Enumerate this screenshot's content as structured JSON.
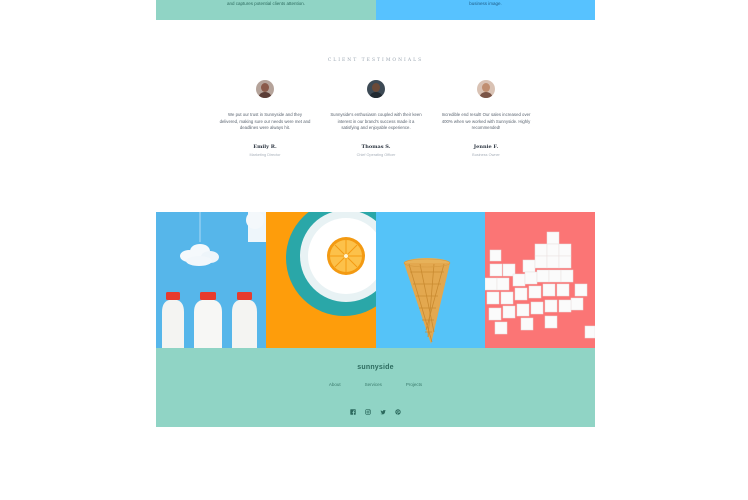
{
  "top_strip": {
    "left_text": "and captures potential clients attention.",
    "right_text": "business image."
  },
  "testimonials": {
    "heading": "CLIENT TESTIMONIALS",
    "items": [
      {
        "quote": "We put our trust in Sunnyside and they delivered, making sure our needs were met and deadlines were always hit.",
        "name": "Emily R.",
        "role": "Marketing Director"
      },
      {
        "quote": "Sunnyside's enthusiasm coupled with their keen interest in our brand's success made it a satisfying and enjoyable experience.",
        "name": "Thomas S.",
        "role": "Chief Operating Officer"
      },
      {
        "quote": "Incredible end result! Our sales increased over 400% when we worked with Sunnyside. Highly recommended!",
        "name": "Jennie F.",
        "role": "Business Owner"
      }
    ]
  },
  "gallery": {
    "images": [
      "milk-bottles-image",
      "orange-plate-image",
      "ice-cream-cone-image",
      "sugar-cubes-image"
    ]
  },
  "footer": {
    "logo": "sunnyside",
    "nav": [
      "About",
      "Services",
      "Projects"
    ],
    "socials": [
      "facebook-icon",
      "instagram-icon",
      "twitter-icon",
      "pinterest-icon"
    ]
  },
  "colors": {
    "mint": "#90d4c5",
    "sky": "#57c2ff",
    "orange": "#fe9d0b",
    "coral": "#fb7575"
  }
}
